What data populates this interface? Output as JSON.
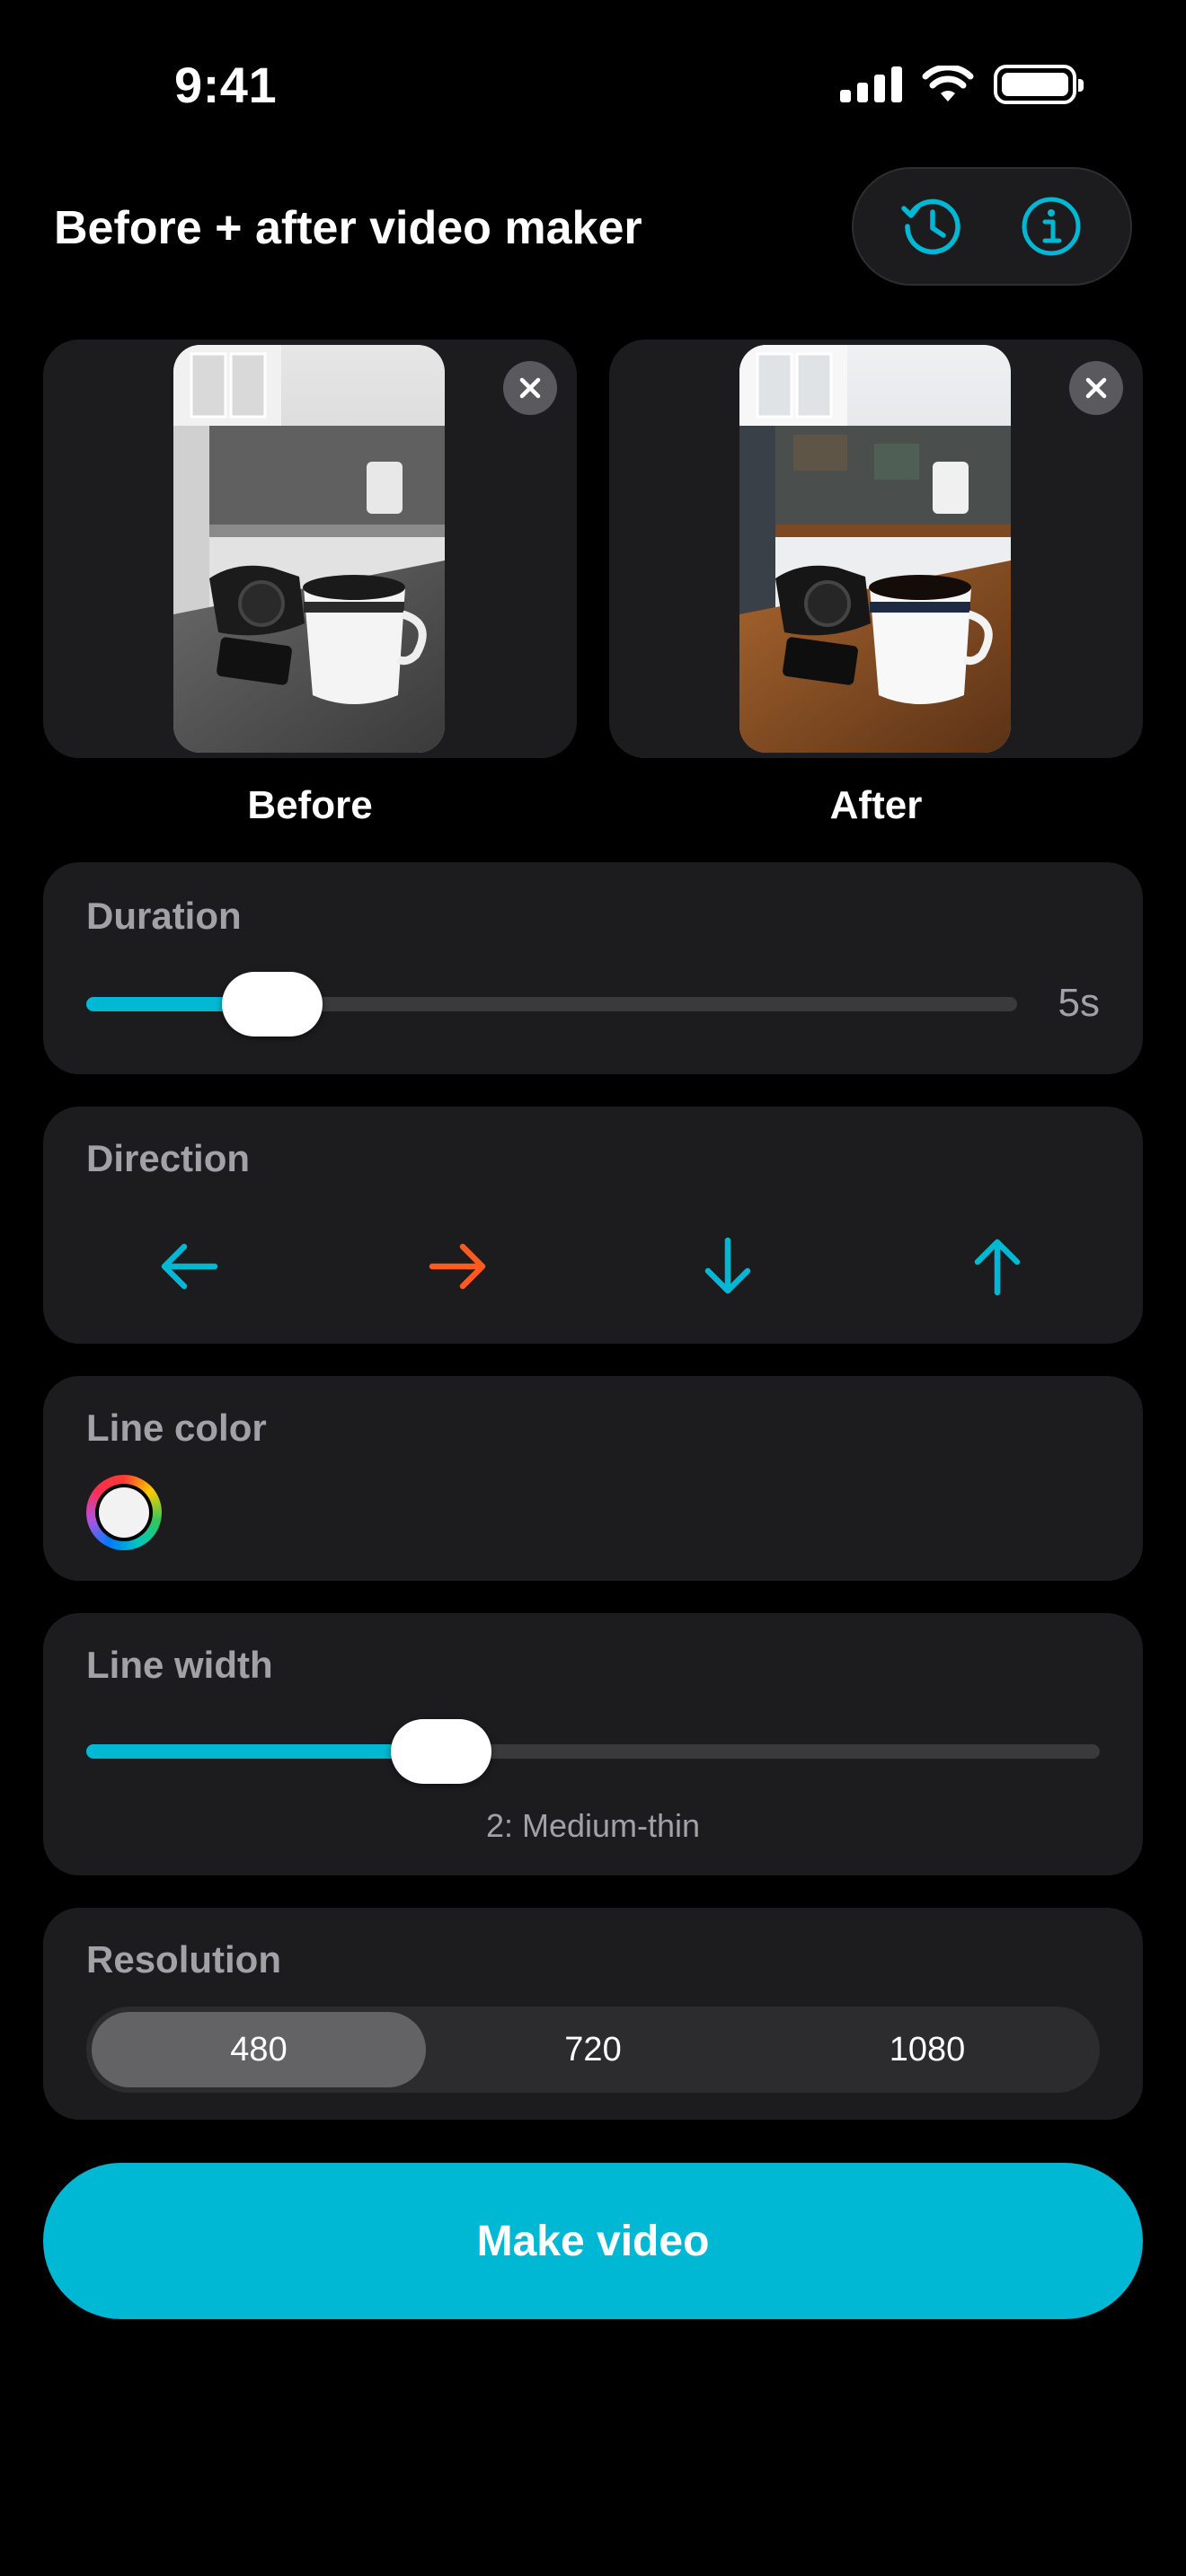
{
  "status_bar": {
    "time": "9:41"
  },
  "header": {
    "title": "Before + after video maker",
    "history_icon": "clock-history-icon",
    "info_icon": "info-circle-icon",
    "accent_color": "#00b8d4"
  },
  "images": {
    "before_label": "Before",
    "after_label": "After",
    "remove_icon": "close-x-icon"
  },
  "duration": {
    "label": "Duration",
    "value": "5s",
    "fraction": 0.2
  },
  "direction": {
    "label": "Direction",
    "options": [
      {
        "icon": "arrow-left-icon",
        "color": "#00b8d4"
      },
      {
        "icon": "arrow-right-icon",
        "color": "#ff5a1f"
      },
      {
        "icon": "arrow-down-icon",
        "color": "#00b8d4"
      },
      {
        "icon": "arrow-up-icon",
        "color": "#00b8d4"
      }
    ]
  },
  "line_color": {
    "label": "Line color",
    "value": "#f2f2f2"
  },
  "line_width": {
    "label": "Line width",
    "value_text": "2: Medium-thin",
    "fraction": 0.35
  },
  "resolution": {
    "label": "Resolution",
    "options": [
      "480",
      "720",
      "1080"
    ],
    "selected": "480"
  },
  "cta": {
    "label": "Make video"
  }
}
